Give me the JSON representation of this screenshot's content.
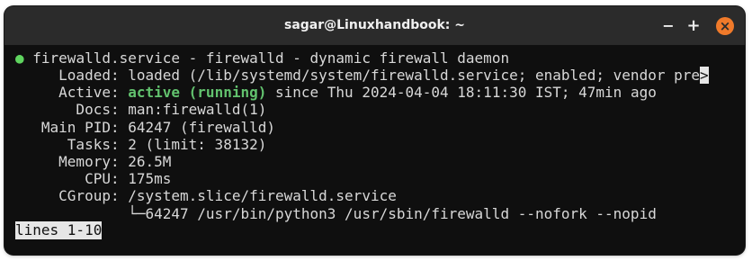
{
  "window": {
    "title": "sagar@Linuxhandbook: ~",
    "buttons": {
      "minimize": "−",
      "maximize": "+",
      "close": "×"
    }
  },
  "terminal": {
    "line1": {
      "bullet": "●",
      "text": " firewalld.service - firewalld - dynamic firewall daemon"
    },
    "line2": {
      "text": "     Loaded: loaded (/lib/systemd/system/firewalld.service; enabled; vendor pre",
      "overflow": ">"
    },
    "line3": {
      "label": "     Active: ",
      "status": "active (running)",
      "rest": " since Thu 2024-04-04 18:11:30 IST; 47min ago"
    },
    "line4": "       Docs: man:firewalld(1)",
    "line5": "   Main PID: 64247 (firewalld)",
    "line6": "      Tasks: 2 (limit: 38132)",
    "line7": "     Memory: 26.5M",
    "line8": "        CPU: 175ms",
    "line9": "     CGroup: /system.slice/firewalld.service",
    "line10": "             └─64247 /usr/bin/python3 /usr/sbin/firewalld --nofork --nopid",
    "pager_status": "lines 1-10"
  },
  "colors": {
    "active_status": "#62c26e",
    "bullet": "#5fd45f",
    "close_button": "#f07a2a"
  }
}
